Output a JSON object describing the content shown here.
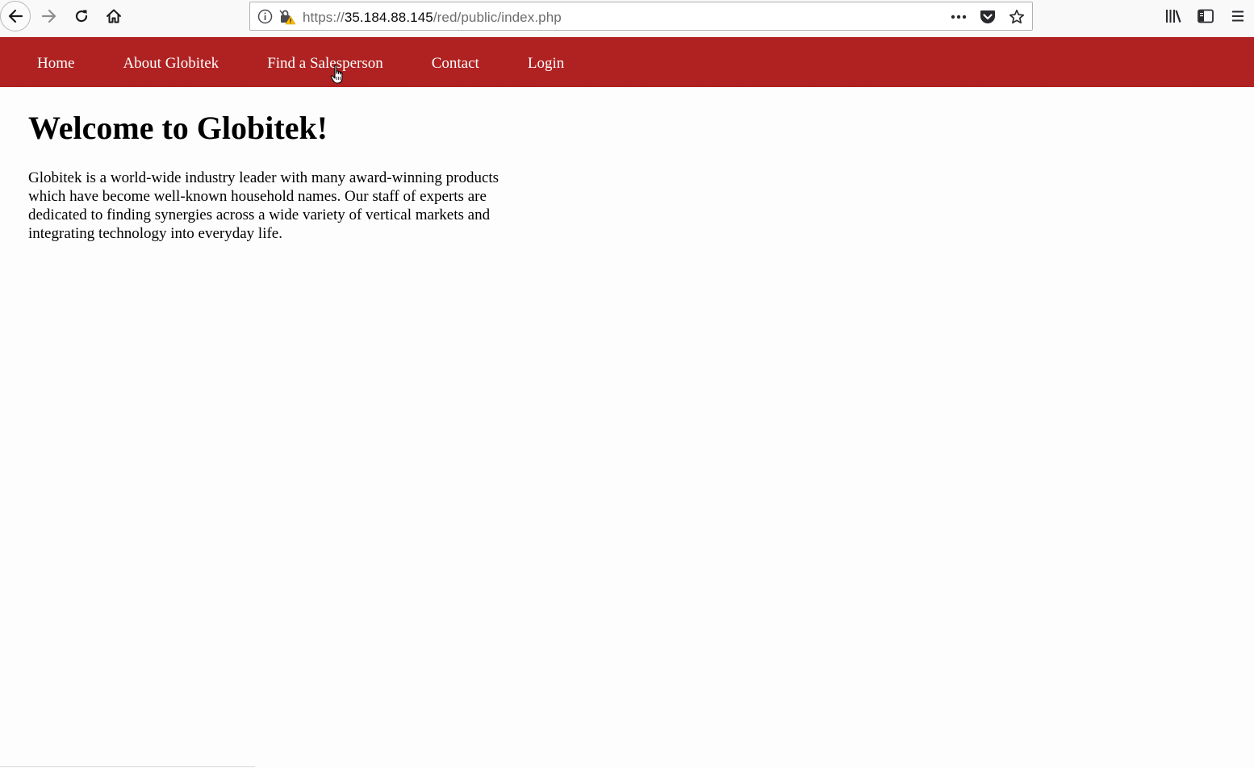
{
  "browser": {
    "url_prefix": "https://",
    "url_host": "35.184.88.145",
    "url_path": "/red/public/index.php",
    "icons": {
      "back": "back-arrow-icon",
      "forward": "forward-arrow-icon",
      "reload": "reload-icon",
      "home": "home-icon",
      "info": "info-icon",
      "insecure": "insecure-lock-icon",
      "page_actions": "more-dots-icon",
      "pocket": "pocket-icon",
      "bookmark": "star-icon",
      "library": "library-icon",
      "sidebar": "sidebar-icon",
      "menu": "hamburger-menu-icon"
    }
  },
  "nav": {
    "items": [
      {
        "label": "Home"
      },
      {
        "label": "About Globitek"
      },
      {
        "label": "Find a Salesperson"
      },
      {
        "label": "Contact"
      },
      {
        "label": "Login"
      }
    ],
    "background": "#b22222"
  },
  "main": {
    "heading": "Welcome to Globitek!",
    "body": "Globitek is a world-wide industry leader with many award-winning products which have become well-known household names. Our staff of experts are dedicated to finding synergies across a wide variety of vertical markets and integrating technology into everyday life."
  }
}
